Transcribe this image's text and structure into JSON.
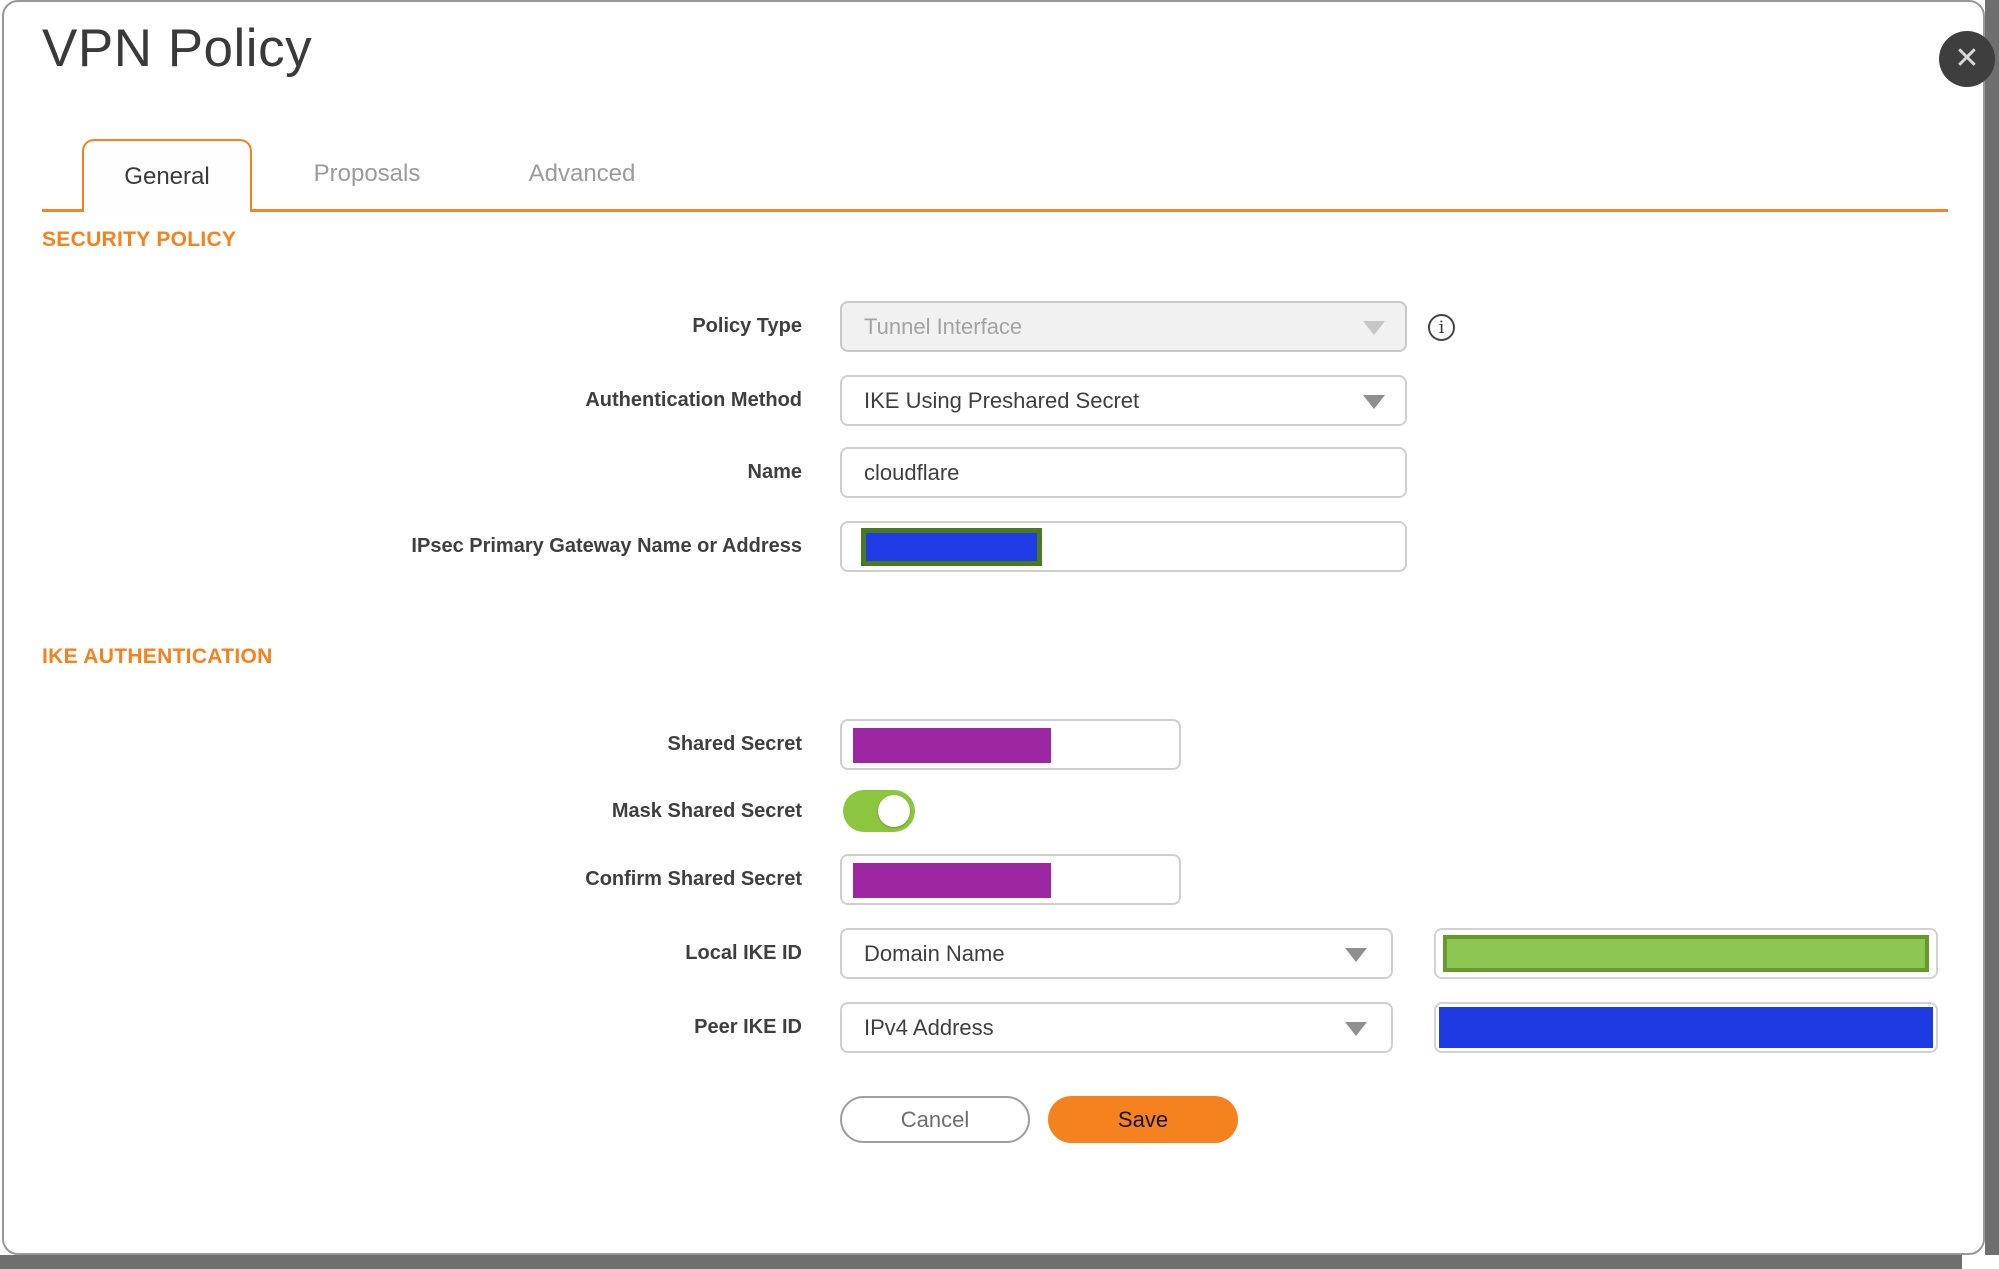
{
  "dialog": {
    "title": "VPN Policy",
    "close_icon": "✕"
  },
  "tabs": [
    {
      "label": "General",
      "active": true
    },
    {
      "label": "Proposals",
      "active": false
    },
    {
      "label": "Advanced",
      "active": false
    }
  ],
  "security": {
    "heading": "SECURITY POLICY",
    "policy_type": {
      "label": "Policy Type",
      "value": "Tunnel Interface",
      "disabled": true
    },
    "auth_method": {
      "label": "Authentication Method",
      "value": "IKE Using Preshared Secret"
    },
    "name": {
      "label": "Name",
      "value": "cloudflare"
    },
    "gateway": {
      "label": "IPsec Primary Gateway Name or Address",
      "value": "",
      "redacted": true
    },
    "info_icon_glyph": "i"
  },
  "ike": {
    "heading": "IKE AUTHENTICATION",
    "shared_secret": {
      "label": "Shared Secret",
      "redacted": true
    },
    "mask_shared_secret": {
      "label": "Mask Shared Secret",
      "enabled": true
    },
    "confirm_shared_secret": {
      "label": "Confirm Shared Secret",
      "redacted": true
    },
    "local_ike_id": {
      "label": "Local IKE ID",
      "value": "Domain Name",
      "id_redacted": true
    },
    "peer_ike_id": {
      "label": "Peer IKE ID",
      "value": "IPv4 Address",
      "id_redacted": true
    }
  },
  "buttons": {
    "cancel": "Cancel",
    "save": "Save"
  },
  "colors": {
    "accent_orange": "#F6821F",
    "save_bg": "#F6821F",
    "redaction_purple": "#9C27A0",
    "redaction_blue": "#1D3AE3",
    "gateway_blue_fill": "#1F3BE5",
    "gateway_green_border": "#4A7A1F",
    "local_green_fill": "#8DC653",
    "local_green_border": "#68992C",
    "toggle_green": "#8CC63F"
  }
}
